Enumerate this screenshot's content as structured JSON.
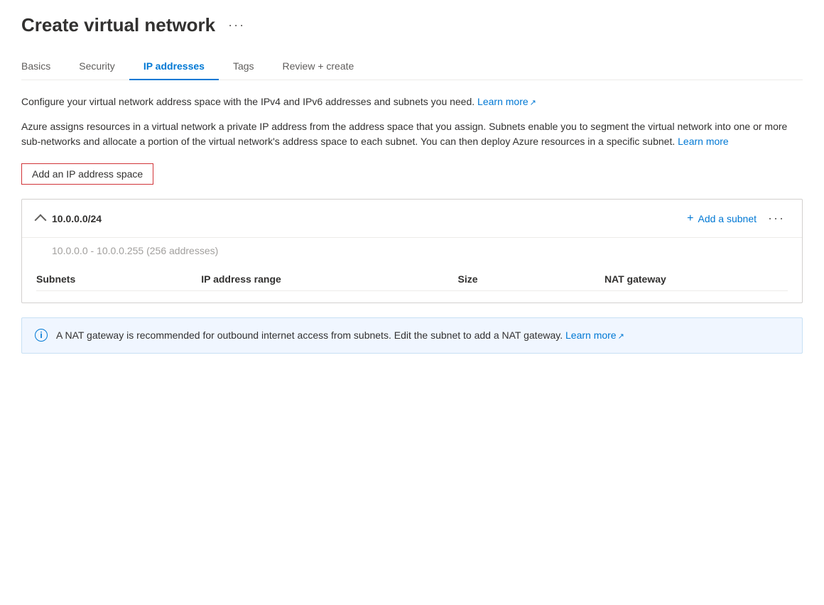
{
  "page": {
    "title": "Create virtual network",
    "ellipsis": "···"
  },
  "tabs": [
    {
      "id": "basics",
      "label": "Basics",
      "active": false
    },
    {
      "id": "security",
      "label": "Security",
      "active": false
    },
    {
      "id": "ip-addresses",
      "label": "IP addresses",
      "active": true
    },
    {
      "id": "tags",
      "label": "Tags",
      "active": false
    },
    {
      "id": "review-create",
      "label": "Review + create",
      "active": false
    }
  ],
  "description1": "Configure your virtual network address space with the IPv4 and IPv6 addresses and subnets you need.",
  "description1_learn_more": "Learn more",
  "description2": "Azure assigns resources in a virtual network a private IP address from the address space that you assign. Subnets enable you to segment the virtual network into one or more sub-networks and allocate a portion of the virtual network's address space to each subnet. You can then deploy Azure resources in a specific subnet.",
  "description2_learn_more": "Learn more",
  "add_ip_btn": "Add an IP address space",
  "ip_space": {
    "cidr": "10.0.0.0/24",
    "range_label": "10.0.0.0 - 10.0.0.255 (256 addresses)",
    "add_subnet_btn": "Add a subnet",
    "more_ellipsis": "···",
    "table": {
      "columns": [
        "Subnets",
        "IP address range",
        "Size",
        "NAT gateway"
      ]
    }
  },
  "info_box": {
    "message": "A NAT gateway is recommended for outbound internet access from subnets. Edit the subnet to add a NAT gateway.",
    "learn_more": "Learn more"
  }
}
